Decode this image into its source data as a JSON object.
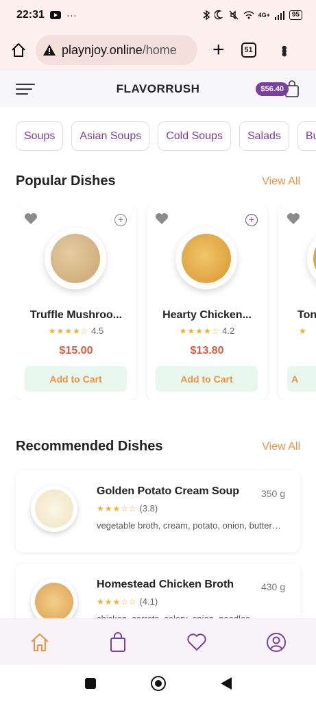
{
  "status_bar": {
    "time": "22:31",
    "dots": "···",
    "network": "4G+",
    "battery": "95",
    "icons": [
      "youtube-icon",
      "bluetooth-icon",
      "moon-icon",
      "mute-icon",
      "vowifi-icon",
      "signal-icon",
      "battery-icon"
    ]
  },
  "browser": {
    "url_host": "playnjoy.online",
    "url_path": "/home",
    "tab_count": "51",
    "icons": [
      "home-icon",
      "warning-icon",
      "plus-icon",
      "tabs-icon",
      "more-vert-icon"
    ]
  },
  "header": {
    "title": "FLAVORRUSH",
    "cart_total": "$56.40"
  },
  "categories": [
    "Soups",
    "Asian Soups",
    "Cold Soups",
    "Salads",
    "Bu"
  ],
  "popular": {
    "title": "Popular Dishes",
    "view_all": "View All",
    "items": [
      {
        "name": "Truffle Mushroo...",
        "stars": "★★★★☆",
        "rating": "4.5",
        "price": "$15.00",
        "button": "Add to Cart",
        "soup_color": "#d8b889"
      },
      {
        "name": "Hearty Chicken...",
        "stars": "★★★★☆",
        "rating": "4.2",
        "price": "$13.80",
        "button": "Add to Cart",
        "soup_color": "#e3b253"
      },
      {
        "name": "Ton",
        "stars": "★",
        "rating": "",
        "price": "",
        "button": "A",
        "soup_color": "#e0a94a"
      }
    ]
  },
  "recommended": {
    "title": "Recommended Dishes",
    "view_all": "View All",
    "items": [
      {
        "name": "Golden Potato Cream Soup",
        "weight": "350 g",
        "stars": "★★★☆☆",
        "rating": "(3.8)",
        "ingredients": "vegetable broth, cream, potato, onion, butter…",
        "soup_color": "#f3ead3"
      },
      {
        "name": "Homestead Chicken Broth",
        "weight": "430 g",
        "stars": "★★★☆☆",
        "rating": "(4.1)",
        "ingredients": "chicken, carrots, celery, onion, noodles",
        "soup_color": "#e8b76a"
      }
    ]
  },
  "bottom_nav": [
    "home-icon",
    "bag-icon",
    "heart-icon",
    "profile-icon"
  ],
  "colors": {
    "accent": "#7b3fa0",
    "orange": "#f0913a",
    "price_red": "#e2583d",
    "button_bg": "#e8f7ee",
    "star": "#f2b322"
  }
}
